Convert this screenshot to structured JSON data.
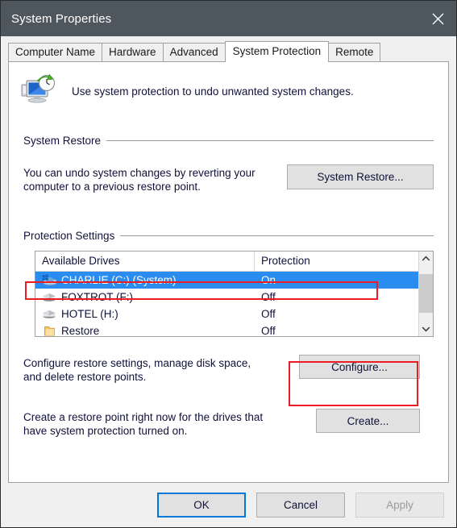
{
  "window": {
    "title": "System Properties",
    "close_icon": "close-icon"
  },
  "tabs": [
    {
      "label": "Computer Name",
      "active": false
    },
    {
      "label": "Hardware",
      "active": false
    },
    {
      "label": "Advanced",
      "active": false
    },
    {
      "label": "System Protection",
      "active": true
    },
    {
      "label": "Remote",
      "active": false
    }
  ],
  "header": {
    "icon": "system-protection-icon",
    "text": "Use system protection to undo unwanted system changes."
  },
  "system_restore": {
    "group_label": "System Restore",
    "description": "You can undo system changes by reverting your computer to a previous restore point.",
    "button_label": "System Restore..."
  },
  "protection_settings": {
    "group_label": "Protection Settings",
    "columns": [
      "Available Drives",
      "Protection"
    ],
    "rows": [
      {
        "icon": "system-drive-icon",
        "name": "CHARLIE (C:) (System)",
        "protection": "On",
        "selected": true
      },
      {
        "icon": "drive-icon",
        "name": "FOXTROT (F:)",
        "protection": "Off",
        "selected": false
      },
      {
        "icon": "drive-icon",
        "name": "HOTEL (H:)",
        "protection": "Off",
        "selected": false
      },
      {
        "icon": "folder-icon",
        "name": "Restore",
        "protection": "Off",
        "selected": false
      }
    ],
    "scroll_up_icon": "chevron-up-icon",
    "scroll_down_icon": "chevron-down-icon",
    "configure_description": "Configure restore settings, manage disk space, and delete restore points.",
    "configure_button_label": "Configure...",
    "create_description": "Create a restore point right now for the drives that have system protection turned on.",
    "create_button_label": "Create..."
  },
  "footer": {
    "ok_label": "OK",
    "cancel_label": "Cancel",
    "apply_label": "Apply"
  },
  "colors": {
    "titlebar": "#4f575e",
    "selection": "#2b8cef",
    "annotation": "#ec1c24",
    "focus": "#0078d7"
  }
}
